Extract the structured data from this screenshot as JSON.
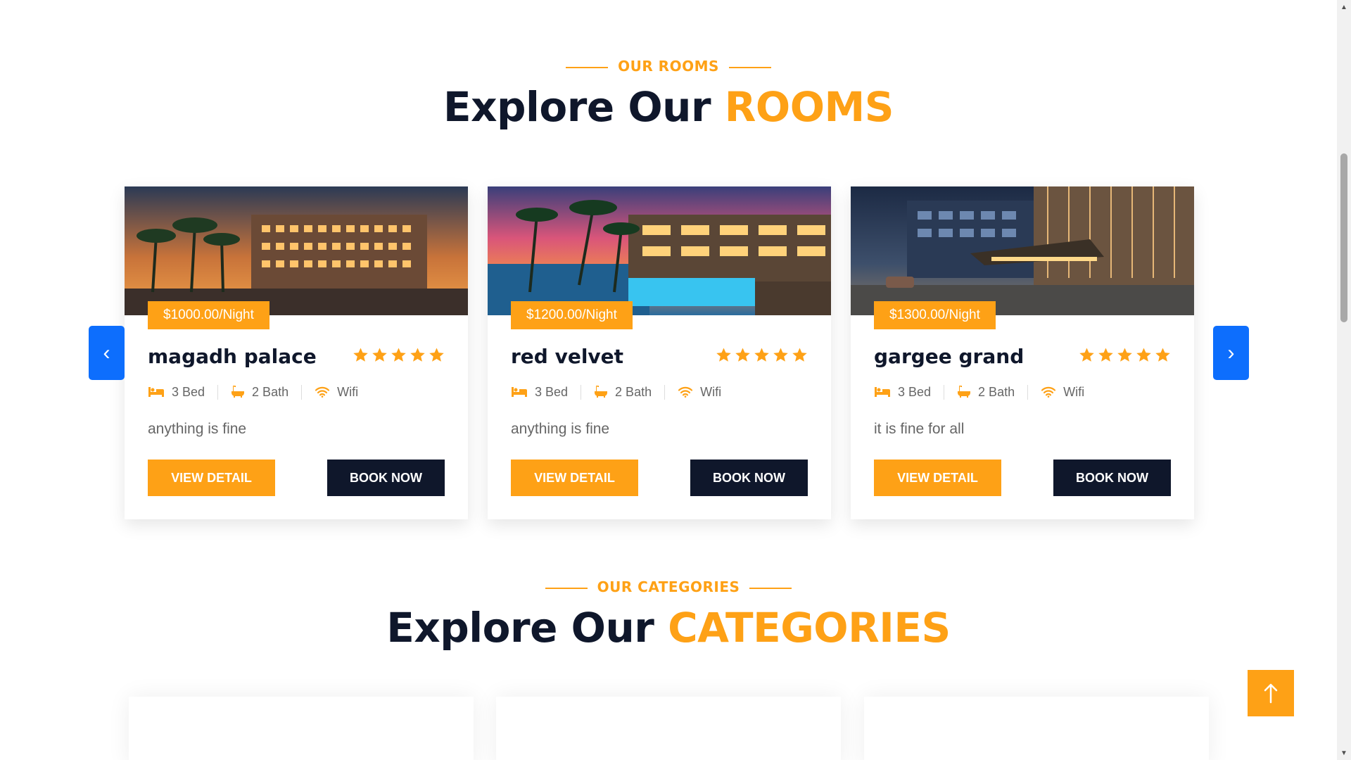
{
  "rooms_section": {
    "tag": "OUR ROOMS",
    "title_main": "Explore Our",
    "title_accent": "ROOMS",
    "prev_arrow": "‹",
    "next_arrow": "›",
    "rooms": [
      {
        "price": "$1000.00/Night",
        "name": "magadh palace",
        "beds": "3 Bed",
        "baths": "2 Bath",
        "wifi": "Wifi",
        "description": "anything is fine",
        "view_label": "VIEW DETAIL",
        "book_label": "BOOK NOW",
        "rating": 5
      },
      {
        "price": "$1200.00/Night",
        "name": "red velvet",
        "beds": "3 Bed",
        "baths": "2 Bath",
        "wifi": "Wifi",
        "description": "anything is fine",
        "view_label": "VIEW DETAIL",
        "book_label": "BOOK NOW",
        "rating": 5
      },
      {
        "price": "$1300.00/Night",
        "name": "gargee grand",
        "beds": "3 Bed",
        "baths": "2 Bath",
        "wifi": "Wifi",
        "description": "it is fine for all",
        "view_label": "VIEW DETAIL",
        "book_label": "BOOK NOW",
        "rating": 5
      }
    ]
  },
  "categories_section": {
    "tag": "OUR CATEGORIES",
    "title_main": "Explore Our",
    "title_accent": "CATEGORIES"
  },
  "icons": {
    "bed": "bed-icon",
    "bath": "bath-icon",
    "wifi": "wifi-icon",
    "star": "star-icon",
    "back_to_top": "arrow-up-icon"
  },
  "colors": {
    "primary": "#FEA116",
    "dark": "#0f172b",
    "nav_blue": "#0d6efd",
    "text_muted": "#666666"
  }
}
